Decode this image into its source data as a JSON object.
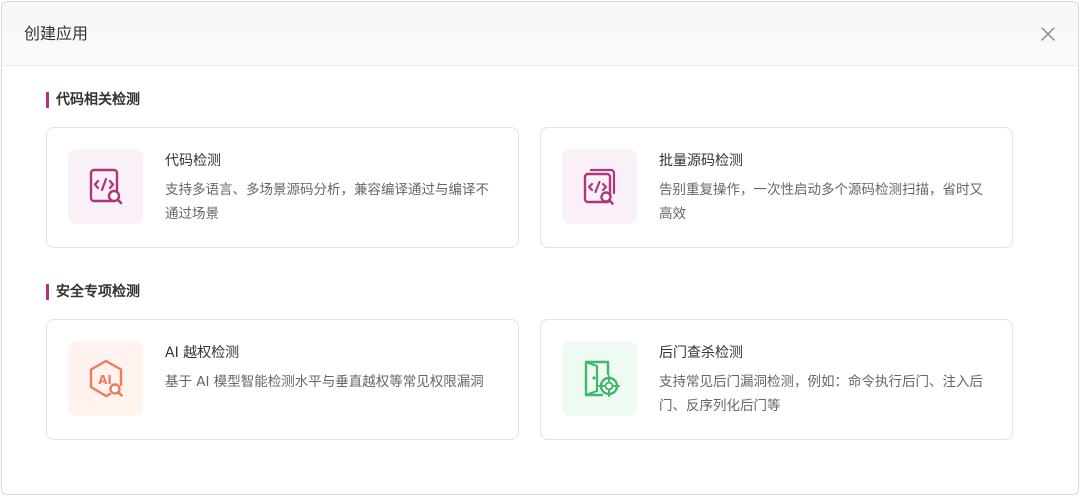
{
  "dialog": {
    "title": "创建应用"
  },
  "sections": [
    {
      "title": "代码相关检测",
      "cards": [
        {
          "title": "代码检测",
          "desc": "支持多语言、多场景源码分析，兼容编译通过与编译不通过场景",
          "icon": "code-scan-icon"
        },
        {
          "title": "批量源码检测",
          "desc": "告别重复操作，一次性启动多个源码检测扫描，省时又高效",
          "icon": "batch-code-scan-icon"
        }
      ]
    },
    {
      "title": "安全专项检测",
      "cards": [
        {
          "title": "AI 越权检测",
          "desc": "基于 AI 模型智能检测水平与垂直越权等常见权限漏洞",
          "icon": "ai-scan-icon",
          "icon_text": "AI"
        },
        {
          "title": "后门查杀检测",
          "desc": "支持常见后门漏洞检测，例如：命令执行后门、注入后门、反序列化后门等",
          "icon": "backdoor-scan-icon"
        }
      ]
    }
  ],
  "colors": {
    "accent": "#b0347e",
    "orange": "#f07b5a",
    "green": "#3fb86a"
  }
}
